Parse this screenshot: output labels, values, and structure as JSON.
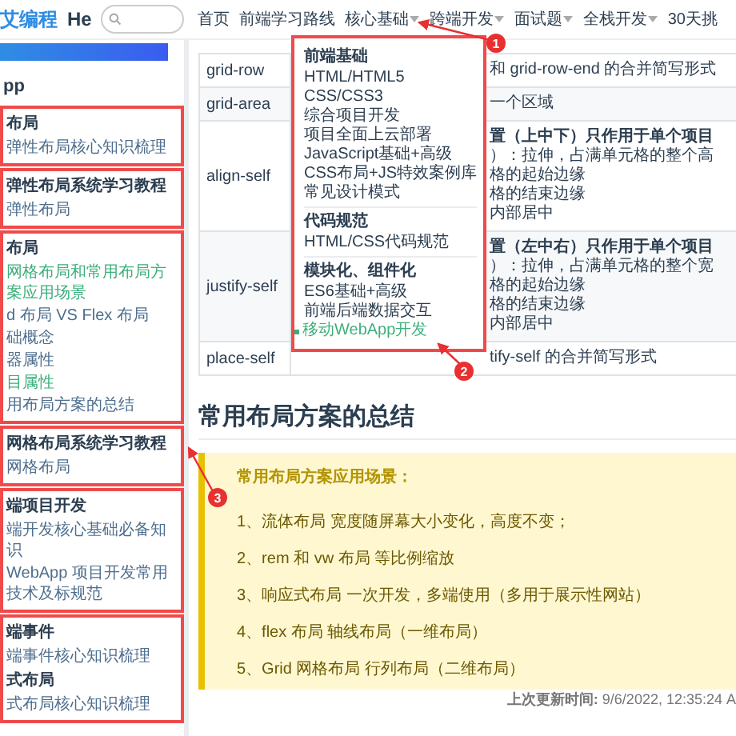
{
  "header": {
    "logo": "艾编程",
    "site_name": "He"
  },
  "nav": [
    {
      "label": "首页",
      "has_menu": false
    },
    {
      "label": "前端学习路线",
      "has_menu": false
    },
    {
      "label": "核心基础",
      "has_menu": true
    },
    {
      "label": "跨端开发",
      "has_menu": true
    },
    {
      "label": "面试题",
      "has_menu": true
    },
    {
      "label": "全栈开发",
      "has_menu": true
    },
    {
      "label": "30天挑",
      "has_menu": false
    }
  ],
  "dropdown": {
    "groups": [
      {
        "heading": "前端基础",
        "items": [
          {
            "label": "HTML/HTML5",
            "selected": false
          },
          {
            "label": "CSS/CSS3",
            "selected": false
          },
          {
            "label": "综合项目开发",
            "selected": false
          },
          {
            "label": "项目全面上云部署",
            "selected": false
          },
          {
            "label": "JavaScript基础+高级",
            "selected": false
          },
          {
            "label": "CSS布局+JS特效案例库",
            "selected": false
          },
          {
            "label": "常见设计模式",
            "selected": false
          }
        ]
      },
      {
        "heading": "代码规范",
        "items": [
          {
            "label": "HTML/CSS代码规范",
            "selected": false
          }
        ]
      },
      {
        "heading": "模块化、组件化",
        "items": [
          {
            "label": "ES6基础+高级",
            "selected": false
          },
          {
            "label": "前端后端数据交互",
            "selected": false
          },
          {
            "label": "移动WebApp开发",
            "selected": true
          }
        ]
      }
    ]
  },
  "sidebar": {
    "title": "pp",
    "groups": [
      {
        "highlighted": true,
        "items": [
          {
            "kind": "title",
            "text": "布局"
          },
          {
            "kind": "link",
            "text": "弹性布局核心知识梳理",
            "selected": false
          }
        ]
      },
      {
        "highlighted": true,
        "items": [
          {
            "kind": "title",
            "text": "弹性布局系统学习教程"
          },
          {
            "kind": "link",
            "text": "弹性布局",
            "selected": false
          }
        ]
      },
      {
        "highlighted": true,
        "items": [
          {
            "kind": "title",
            "text": "布局"
          },
          {
            "kind": "link",
            "text": "网格布局和常用布局方案应用场景",
            "selected": true
          },
          {
            "kind": "link",
            "text": "d 布局 VS Flex 布局",
            "selected": false
          },
          {
            "kind": "link",
            "text": "础概念",
            "selected": false
          },
          {
            "kind": "link",
            "text": "器属性",
            "selected": false
          },
          {
            "kind": "link",
            "text": "目属性",
            "selected": true
          },
          {
            "kind": "link",
            "text": "用布局方案的总结",
            "selected": false
          }
        ]
      },
      {
        "highlighted": true,
        "items": [
          {
            "kind": "title",
            "text": "网格布局系统学习教程"
          },
          {
            "kind": "link",
            "text": "网格布局",
            "selected": false
          }
        ]
      },
      {
        "highlighted": true,
        "items": [
          {
            "kind": "title",
            "text": "端项目开发"
          },
          {
            "kind": "link",
            "text": "端开发核心基础必备知识",
            "selected": false
          },
          {
            "kind": "link",
            "text": "WebApp 项目开发常用技术及标规范",
            "selected": false
          }
        ]
      },
      {
        "highlighted": true,
        "items": [
          {
            "kind": "title",
            "text": "端事件"
          },
          {
            "kind": "link",
            "text": "端事件核心知识梳理",
            "selected": false
          },
          {
            "kind": "title",
            "text": "式布局"
          },
          {
            "kind": "link",
            "text": "式布局核心知识梳理",
            "selected": false
          }
        ]
      }
    ]
  },
  "table": {
    "rows": [
      {
        "property": "grid-row",
        "description": [
          "和 grid-row-end 的合并简写形式"
        ]
      },
      {
        "property": "grid-area",
        "description": [
          "一个区域"
        ]
      },
      {
        "property": "align-self",
        "description": [
          "**置（上中下）只作用于单个项目**",
          "）：拉伸，占满单元格的整个高",
          "格的起始边缘",
          "格的结束边缘",
          "内部居中"
        ]
      },
      {
        "property": "justify-self",
        "description": [
          "**置（左中右）只作用于单个项目**",
          "）：拉伸，占满单元格的整个宽",
          "格的起始边缘",
          "格的结束边缘",
          "内部居中"
        ]
      },
      {
        "property": "place-self",
        "description": [
          "tify-self 的合并简写形式"
        ]
      }
    ]
  },
  "section": {
    "heading": "常用布局方案的总结"
  },
  "tip": {
    "title": "常用布局方案应用场景：",
    "items": [
      "1、流体布局 宽度随屏幕大小变化，高度不变；",
      "2、rem 和 vw 布局 等比例缩放",
      "3、响应式布局 一次开发，多端使用（多用于展示性网站）",
      "4、flex 布局 轴线布局（一维布局）",
      "5、Grid 网格布局 行列布局（二维布局）"
    ]
  },
  "footer": {
    "updated": "**上次更新时间:** 9/6/2022, 12:35:24 A"
  },
  "annotations": [
    {
      "number": "1"
    },
    {
      "number": "2"
    },
    {
      "number": "3"
    }
  ]
}
